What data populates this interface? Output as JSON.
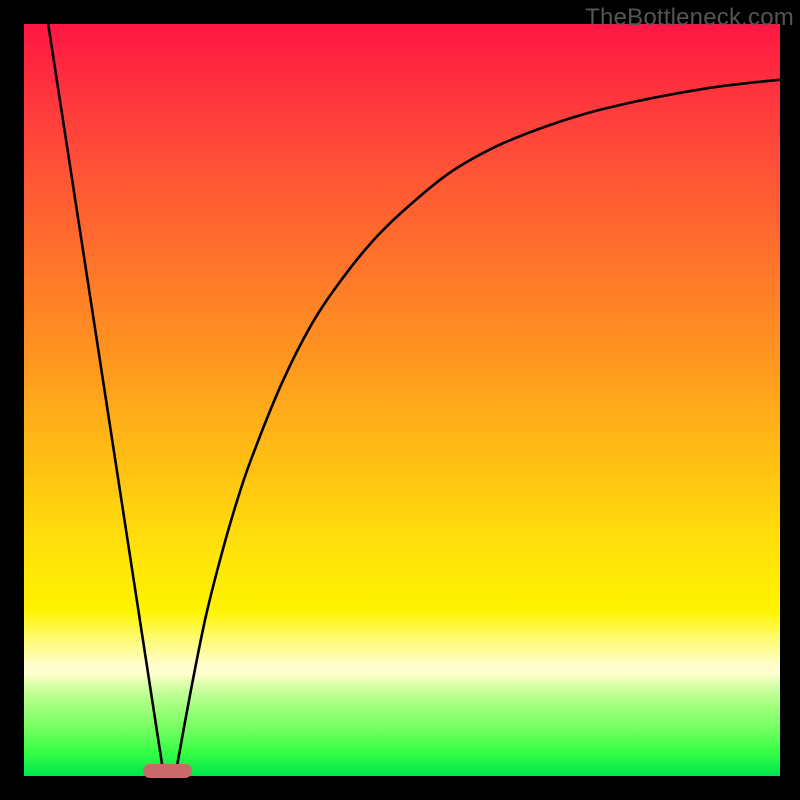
{
  "watermark": "TheBottleneck.com",
  "colors": {
    "frame": "#000000",
    "gradient_top": "#ff1744",
    "gradient_mid": "#ffe20a",
    "gradient_bottom": "#00e54d",
    "curve": "#000000",
    "marker": "#c96a6a"
  },
  "chart_data": {
    "type": "line",
    "title": "",
    "xlabel": "",
    "ylabel": "",
    "xlim": [
      0,
      100
    ],
    "ylim": [
      0,
      100
    ],
    "grid": false,
    "legend": false,
    "annotations": [
      "TheBottleneck.com"
    ],
    "series": [
      {
        "name": "left-linear-descent",
        "x": [
          3.2,
          18.5
        ],
        "y": [
          100,
          0
        ]
      },
      {
        "name": "right-curve",
        "x": [
          20,
          22,
          24,
          26,
          28,
          30,
          34,
          38,
          42,
          46,
          50,
          56,
          62,
          68,
          74,
          80,
          86,
          92,
          100
        ],
        "y": [
          0,
          11,
          21,
          29,
          36,
          42,
          52,
          60,
          66,
          71,
          75,
          80,
          83.5,
          86,
          88,
          89.5,
          90.7,
          91.7,
          92.6
        ]
      }
    ],
    "marker": {
      "name": "bottom-pill",
      "x_center": 19,
      "y": 0,
      "width_pct": 6.5,
      "shape": "rounded-rect"
    }
  }
}
